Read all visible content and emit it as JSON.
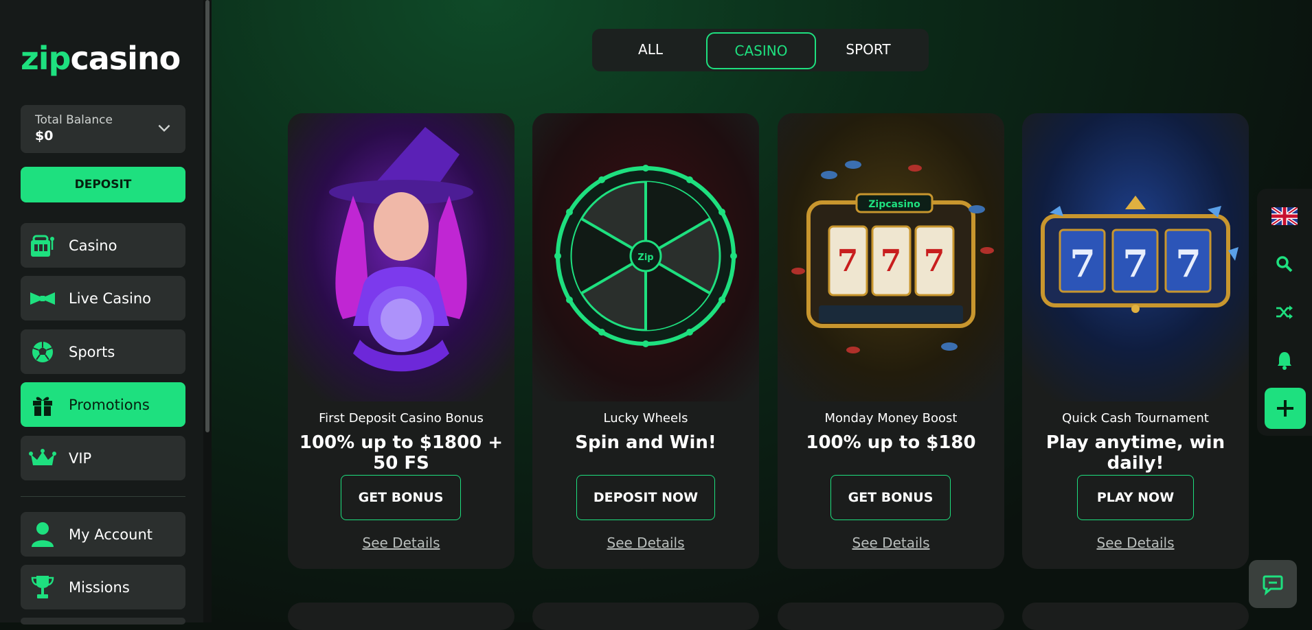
{
  "brand": {
    "logo_zip": "zip",
    "logo_casino": "casino",
    "accent": "#1ee07f"
  },
  "sidebar": {
    "balance_label": "Total Balance",
    "balance_value": "$0",
    "deposit_label": "DEPOSIT",
    "items": [
      {
        "label": "Casino",
        "icon": "slot-machine-icon"
      },
      {
        "label": "Live Casino",
        "icon": "bow-tie-icon"
      },
      {
        "label": "Sports",
        "icon": "soccer-ball-icon"
      },
      {
        "label": "Promotions",
        "icon": "gift-icon",
        "active": true
      },
      {
        "label": "VIP",
        "icon": "crown-icon"
      },
      {
        "label": "My Account",
        "icon": "user-icon"
      },
      {
        "label": "Missions",
        "icon": "trophy-icon"
      }
    ]
  },
  "tabs": [
    {
      "label": "ALL"
    },
    {
      "label": "CASINO",
      "active": true
    },
    {
      "label": "SPORT"
    }
  ],
  "promotions": [
    {
      "subtitle": "First Deposit Casino Bonus",
      "headline": "100% up to $1800 + 50 FS",
      "cta": "GET BONUS",
      "details": "See Details",
      "art": "witch-illustration"
    },
    {
      "subtitle": "Lucky Wheels",
      "headline": "Spin and Win!",
      "cta": "DEPOSIT NOW",
      "details": "See Details",
      "art": "wheel-illustration",
      "wheel_badge": "Zip"
    },
    {
      "subtitle": "Monday Money Boost",
      "headline": "100% up to $180",
      "cta": "GET BONUS",
      "details": "See Details",
      "art": "slot-machine-illustration",
      "sign_text": "Zipcasino",
      "reels": [
        "7",
        "7",
        "7"
      ]
    },
    {
      "subtitle": "Quick Cash Tournament",
      "headline": "Play anytime, win daily!",
      "cta": "PLAY NOW",
      "details": "See Details",
      "art": "treasure-777-illustration",
      "reels": [
        "7",
        "7",
        "7"
      ]
    }
  ],
  "rail": [
    "uk-flag-icon",
    "search-icon",
    "shuffle-icon",
    "bell-icon",
    "plus-icon"
  ],
  "chat_icon": "chat-icon"
}
